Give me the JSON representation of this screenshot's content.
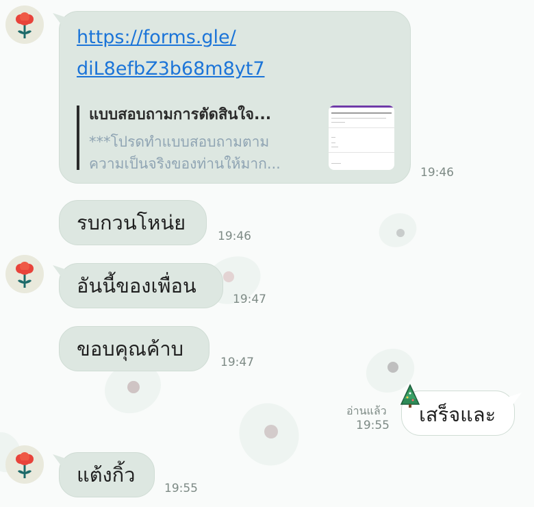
{
  "colors": {
    "background": "#f9fbfa",
    "bubble_incoming": "#dde7e1",
    "bubble_outgoing": "#ffffff",
    "link": "#1b74d8",
    "timestamp": "#7d8a85"
  },
  "avatar_icon": "red-flower-icon",
  "sticker_icon": "christmas-tree-icon",
  "messages": {
    "link_message": {
      "url_line1": "https://forms.gle/",
      "url_line2": "diL8efbZ3b68m8yt7",
      "preview_title": "แบบสอบถามการตัดสินใจ...",
      "preview_desc_line1": "***โปรดทำแบบสอบถามตาม",
      "preview_desc_line2": "ความเป็นจริงของท่านให้มาก...",
      "time": "19:46"
    },
    "m2": {
      "text": "รบกวนโหน่ย",
      "time": "19:46"
    },
    "m3": {
      "text": "อันนี้ของเพื่อน",
      "time": "19:47"
    },
    "m4": {
      "text": "ขอบคุณค้าบ",
      "time": "19:47"
    },
    "m5": {
      "text": "เสร็จและ",
      "time": "19:55",
      "read_label": "อ่านแล้ว"
    },
    "m6": {
      "text": "แต้งกิ้ว",
      "time": "19:55"
    }
  }
}
